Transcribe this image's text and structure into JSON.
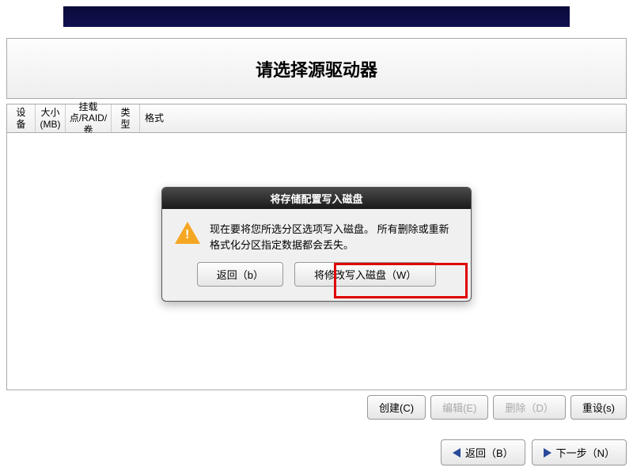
{
  "header": {
    "title": "请选择源驱动器"
  },
  "columns": [
    "设备",
    "大小(MB)",
    "挂载点/RAID/卷",
    "类型",
    "格式"
  ],
  "toolbar": {
    "create": "创建(C)",
    "edit": "编辑(E)",
    "delete": "删除（D）",
    "reset": "重设(s)"
  },
  "nav": {
    "back": "返回（B）",
    "next": "下一步（N）"
  },
  "dialog": {
    "title": "将存储配置写入磁盘",
    "message": "现在要将您所选分区选项写入磁盘。 所有删除或重新格式化分区指定数据都会丢失。",
    "back_btn": "返回（b）",
    "write_btn": "将修改写入磁盘（W）"
  }
}
